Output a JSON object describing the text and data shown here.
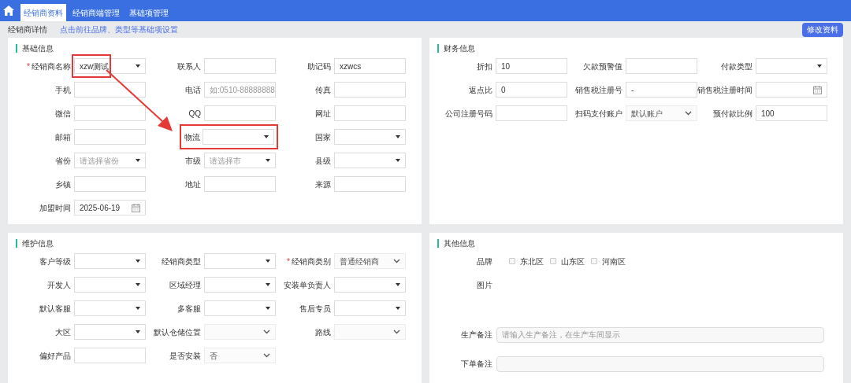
{
  "nav": {
    "tabs": [
      {
        "label": "经销商资料",
        "selected": true
      },
      {
        "label": "经销商端管理",
        "selected": false
      },
      {
        "label": "基础项管理",
        "selected": false
      }
    ]
  },
  "header": {
    "title": "经销商详情",
    "link": "点击前往品牌、类型等基础项设置",
    "button": "修改资料"
  },
  "basic": {
    "title": "基础信息",
    "fields": [
      {
        "label": "经销商名称",
        "kind": "dropdown",
        "value": "xzw测试",
        "required_mark": "*",
        "highlighted": true
      },
      {
        "label": "联系人",
        "kind": "input"
      },
      {
        "label": "助记码",
        "kind": "input",
        "value": "xzwcs"
      },
      {
        "label": "手机",
        "kind": "input"
      },
      {
        "label": "电话",
        "kind": "input",
        "placeholder": "如:0510-88888888"
      },
      {
        "label": "传真",
        "kind": "input"
      },
      {
        "label": "微信",
        "kind": "input"
      },
      {
        "label": "QQ",
        "kind": "input"
      },
      {
        "label": "网址",
        "kind": "input"
      },
      {
        "label": "邮箱",
        "kind": "input"
      },
      {
        "label": "物流",
        "kind": "dropdown",
        "highlighted": true
      },
      {
        "label": "国家",
        "kind": "dropdown"
      },
      {
        "label": "省份",
        "kind": "dropdown",
        "placeholder": "请选择省份"
      },
      {
        "label": "市级",
        "kind": "dropdown",
        "placeholder": "请选择市"
      },
      {
        "label": "县级",
        "kind": "dropdown"
      },
      {
        "label": "乡镇",
        "kind": "input"
      },
      {
        "label": "地址",
        "kind": "input"
      },
      {
        "label": "来源",
        "kind": "input"
      },
      {
        "label": "加盟时间",
        "kind": "date",
        "value": "2025-06-19"
      }
    ]
  },
  "finance": {
    "title": "财务信息",
    "fields": [
      {
        "label": "折扣",
        "kind": "input",
        "value": "10"
      },
      {
        "label": "欠款预警值",
        "kind": "input"
      },
      {
        "label": "付款类型",
        "kind": "dropdown"
      },
      {
        "label": "返点比",
        "kind": "input",
        "value": "0"
      },
      {
        "label": "销售税注册号",
        "kind": "input",
        "value": "-"
      },
      {
        "label": "销售税注册时间",
        "kind": "date"
      },
      {
        "label": "公司注册号码",
        "kind": "input"
      },
      {
        "label": "扫码支付账户",
        "kind": "select",
        "value": "默认账户"
      },
      {
        "label": "预付款比例",
        "kind": "input",
        "value": "100"
      }
    ]
  },
  "maintenance": {
    "title": "维护信息",
    "fields": [
      {
        "label": "客户等级",
        "kind": "dropdown"
      },
      {
        "label": "经销商类型",
        "kind": "dropdown"
      },
      {
        "label": "经销商类别",
        "kind": "select",
        "value": "普通经销商",
        "required_mark": "*"
      },
      {
        "label": "开发人",
        "kind": "dropdown"
      },
      {
        "label": "区域经理",
        "kind": "dropdown"
      },
      {
        "label": "安装单负责人",
        "kind": "dropdown"
      },
      {
        "label": "默认客服",
        "kind": "dropdown"
      },
      {
        "label": "多客服",
        "kind": "dropdown"
      },
      {
        "label": "售后专员",
        "kind": "dropdown"
      },
      {
        "label": "大区",
        "kind": "dropdown"
      },
      {
        "label": "默认仓储位置",
        "kind": "select"
      },
      {
        "label": "路线",
        "kind": "select"
      },
      {
        "label": "偏好产品",
        "kind": "input"
      },
      {
        "label": "是否安装",
        "kind": "select",
        "value": "否"
      }
    ]
  },
  "other": {
    "title": "其他信息",
    "brand_label": "品牌",
    "brands": [
      {
        "label": "东北区",
        "checked": false
      },
      {
        "label": "山东区",
        "checked": false
      },
      {
        "label": "河南区",
        "checked": false
      }
    ],
    "image_label": "图片",
    "notes": [
      {
        "label": "生产备注",
        "placeholder": "请输入生产备注，在生产车间显示"
      },
      {
        "label": "下单备注"
      }
    ]
  }
}
